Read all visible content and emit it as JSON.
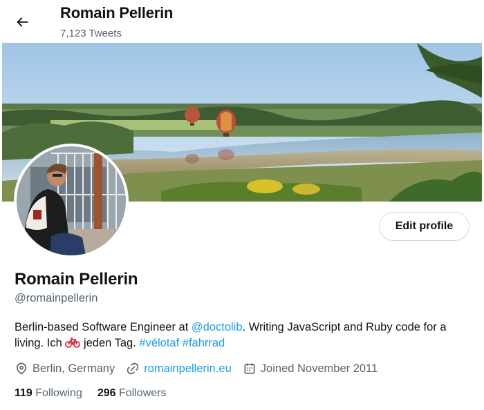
{
  "header": {
    "name": "Romain Pellerin",
    "tweet_count": "7,123 Tweets"
  },
  "profile": {
    "display_name": "Romain Pellerin",
    "handle": "@romainpellerin",
    "edit_label": "Edit profile",
    "bio": {
      "part1": "Berlin-based Software Engineer at ",
      "mention": "@doctolib",
      "part2": ". Writing JavaScript and Ruby code for a living. Ich ",
      "part3": " jeden Tag. ",
      "hashtag1": "#vélotaf",
      "hashtag2": "#fahrrad"
    },
    "location": "Berlin, Germany",
    "website": "romainpellerin.eu",
    "joined": "Joined November 2011",
    "following_count": "119",
    "following_label": "Following",
    "followers_count": "296",
    "followers_label": "Followers"
  },
  "icons": [
    "back-arrow-icon",
    "location-pin-icon",
    "link-icon",
    "calendar-icon",
    "bicycle-icon"
  ],
  "colors": {
    "link": "#1d9bf0",
    "secondary": "#536471",
    "primary": "#0f1419"
  }
}
